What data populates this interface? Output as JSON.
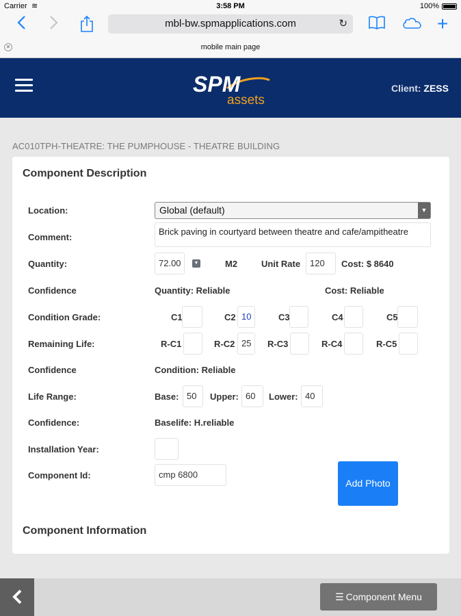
{
  "status": {
    "carrier": "Carrier",
    "time": "3:58 PM",
    "battery": "100%"
  },
  "browser": {
    "url": "mbl-bw.spmapplications.com",
    "tab_title": "mobile main page"
  },
  "header": {
    "logo_top": "SPM",
    "logo_bottom": "assets",
    "client_label": "Client:",
    "client_name": "ZESS"
  },
  "breadcrumb": "AC010TPH-THEATRE: THE PUMPHOUSE - THEATRE BUILDING",
  "card": {
    "title": "Component Description",
    "section2_title": "Component Information",
    "location": {
      "label": "Location:",
      "value": "Global (default)"
    },
    "comment": {
      "label": "Comment:",
      "value": "Brick paving in courtyard between theatre and cafe/ampitheatre"
    },
    "quantity": {
      "label": "Quantity:",
      "value": "72.00",
      "unit": "M2",
      "unit_rate_label": "Unit Rate",
      "unit_rate": "120",
      "cost": "Cost: $ 8640"
    },
    "confidence1": {
      "label": "Confidence",
      "quantity": "Quantity: Reliable",
      "cost": "Cost: Reliable"
    },
    "condition_grade": {
      "label": "Condition Grade:",
      "grades": [
        {
          "label": "C1",
          "value": ""
        },
        {
          "label": "C2",
          "value": "10"
        },
        {
          "label": "C3",
          "value": ""
        },
        {
          "label": "C4",
          "value": ""
        },
        {
          "label": "C5",
          "value": ""
        }
      ]
    },
    "remaining_life": {
      "label": "Remaining Life:",
      "items": [
        {
          "label": "R-C1",
          "value": ""
        },
        {
          "label": "R-C2",
          "value": "25"
        },
        {
          "label": "R-C3",
          "value": ""
        },
        {
          "label": "R-C4",
          "value": ""
        },
        {
          "label": "R-C5",
          "value": ""
        }
      ]
    },
    "confidence2": {
      "label": "Confidence",
      "value": "Condition: Reliable"
    },
    "life_range": {
      "label": "Life Range:",
      "base_label": "Base:",
      "base": "50",
      "upper_label": "Upper:",
      "upper": "60",
      "lower_label": "Lower:",
      "lower": "40"
    },
    "confidence3": {
      "label": "Confidence:",
      "value": "Baselife: H.reliable"
    },
    "installation_year": {
      "label": "Installation Year:",
      "value": ""
    },
    "component_id": {
      "label": "Component Id:",
      "value": "cmp 6800"
    },
    "add_photo": "Add Photo"
  },
  "footer": {
    "menu_label": "Component Menu"
  },
  "colors": {
    "header_bg": "#0b2d6b",
    "accent": "#1a7ff6",
    "logo_orange": "#f0a020"
  }
}
